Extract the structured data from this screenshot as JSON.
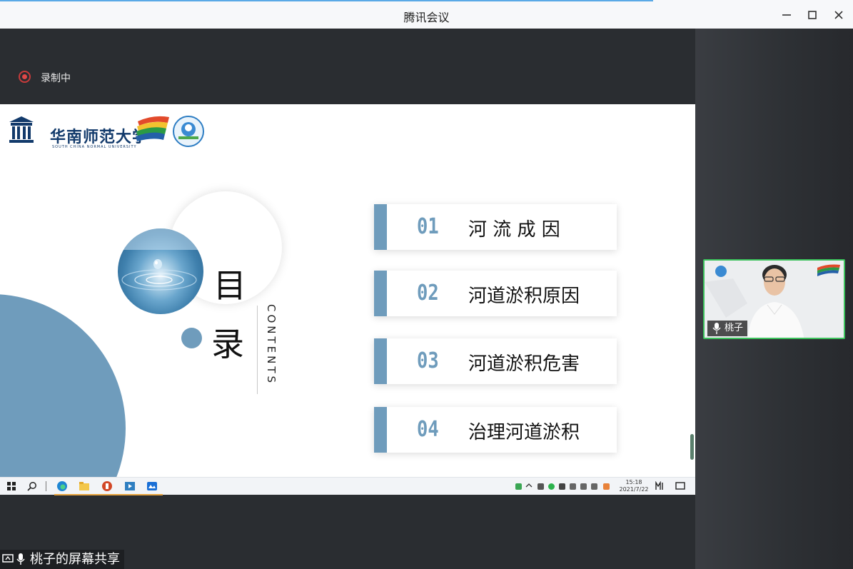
{
  "window": {
    "title": "腾讯会议"
  },
  "recording": {
    "label": "录制中"
  },
  "slide": {
    "university_cn": "华南师范大学",
    "university_en": "SOUTH CHINA NORMAL UNIVERSITY",
    "heading_1": "目",
    "heading_2": "录",
    "contents": "CONTENTS",
    "items": [
      {
        "num": "01",
        "text": "河 流 成 因"
      },
      {
        "num": "02",
        "text": "河道淤积原因"
      },
      {
        "num": "03",
        "text": "河道淤积危害"
      },
      {
        "num": "04",
        "text": "治理河道淤积"
      }
    ],
    "accent_color": "#6f9cbc"
  },
  "taskbar": {
    "time": "15:18",
    "date": "2021/7/22"
  },
  "share": {
    "label": "桃子的屏幕共享"
  },
  "participant": {
    "name": "桃子"
  },
  "colors": {
    "active_border": "#3cc25c",
    "record_red": "#e04848"
  }
}
